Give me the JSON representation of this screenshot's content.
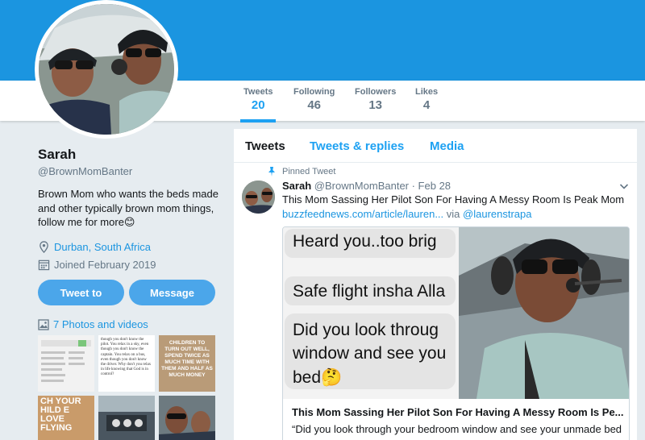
{
  "stats": [
    {
      "label": "Tweets",
      "value": "20"
    },
    {
      "label": "Following",
      "value": "46"
    },
    {
      "label": "Followers",
      "value": "13"
    },
    {
      "label": "Likes",
      "value": "4"
    }
  ],
  "profile": {
    "name": "Sarah",
    "handle": "@BrownMomBanter",
    "bio": "Brown Mom who wants the beds made and other typically brown mom things, follow me for more😊",
    "location": "Durban, South Africa",
    "joined": "Joined February 2019",
    "tweet_to_label": "Tweet to",
    "message_label": "Message",
    "photos_label": "7 Photos and videos"
  },
  "tabs": [
    {
      "label": "Tweets"
    },
    {
      "label": "Tweets & replies"
    },
    {
      "label": "Media"
    }
  ],
  "tweet": {
    "pinned_label": "Pinned Tweet",
    "author": "Sarah",
    "handle_date": "@BrownMomBanter · Feb 28",
    "text": "This Mom Sassing Her Pilot Son For Having A Messy Room Is Peak Mom",
    "link": "buzzfeednews.com/article/lauren...",
    "via_label": "via",
    "via_handle": "@laurenstrapa",
    "card_title": "This Mom Sassing Her Pilot Son For Having A Messy Room Is Pe...",
    "card_desc": "“Did you look through your bedroom window and see your unmade bed",
    "chat_lines": [
      "Heard you..too brig",
      "Safe flight insha Alla",
      "Did you look throug",
      "window and see you",
      "bed🤔"
    ]
  },
  "thumb_text": {
    "t2": "though you don't know the pilot. You relax in a sky, even though you don't know the captain. You relax on a bus, even though you don't know the driver. Why don't you relax in life knowing that God is in control?",
    "t3": "CHILDREN TO TURN OUT WELL, SPEND TWICE AS MUCH TIME WITH THEM AND HALF AS MUCH MONEY",
    "t4": "CH YOUR HILD E LOVE FLYING"
  },
  "colors": {
    "banner": "#1b95e0",
    "accent": "#1da1f2",
    "button": "#4ba6ea"
  }
}
